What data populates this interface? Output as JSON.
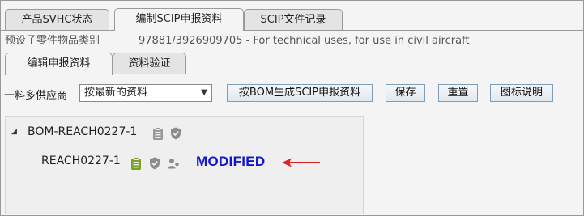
{
  "tabs": [
    {
      "label": "产品SVHC状态",
      "active": false
    },
    {
      "label": "编制SCIP申报资料",
      "active": true
    },
    {
      "label": "SCIP文件记录",
      "active": false
    }
  ],
  "info": {
    "label": "预设子零件物品类别",
    "value": "97881/3926909705 - For technical uses, for use in civil aircraft"
  },
  "subtabs": [
    {
      "label": "编辑申报资料",
      "active": true
    },
    {
      "label": "资料验证",
      "active": false
    }
  ],
  "toolbar": {
    "supplier_label": "一料多供应商",
    "supplier_select": "按最新的资料",
    "buttons": {
      "generate": "按BOM生成SCIP申报资料",
      "save": "保存",
      "reset": "重置",
      "legend": "图标说明"
    }
  },
  "tree": {
    "root": {
      "label": "BOM-REACH0227-1",
      "icons": [
        "clipboard-icon",
        "shield-icon"
      ],
      "expanded": true
    },
    "child": {
      "label": "REACH0227-1",
      "icons": [
        "clipboard-icon",
        "shield-icon",
        "suppliers-icon"
      ]
    }
  },
  "annotation": {
    "text": "MODIFIED",
    "text_color": "#1417c8",
    "arrow_color": "#e02020"
  }
}
